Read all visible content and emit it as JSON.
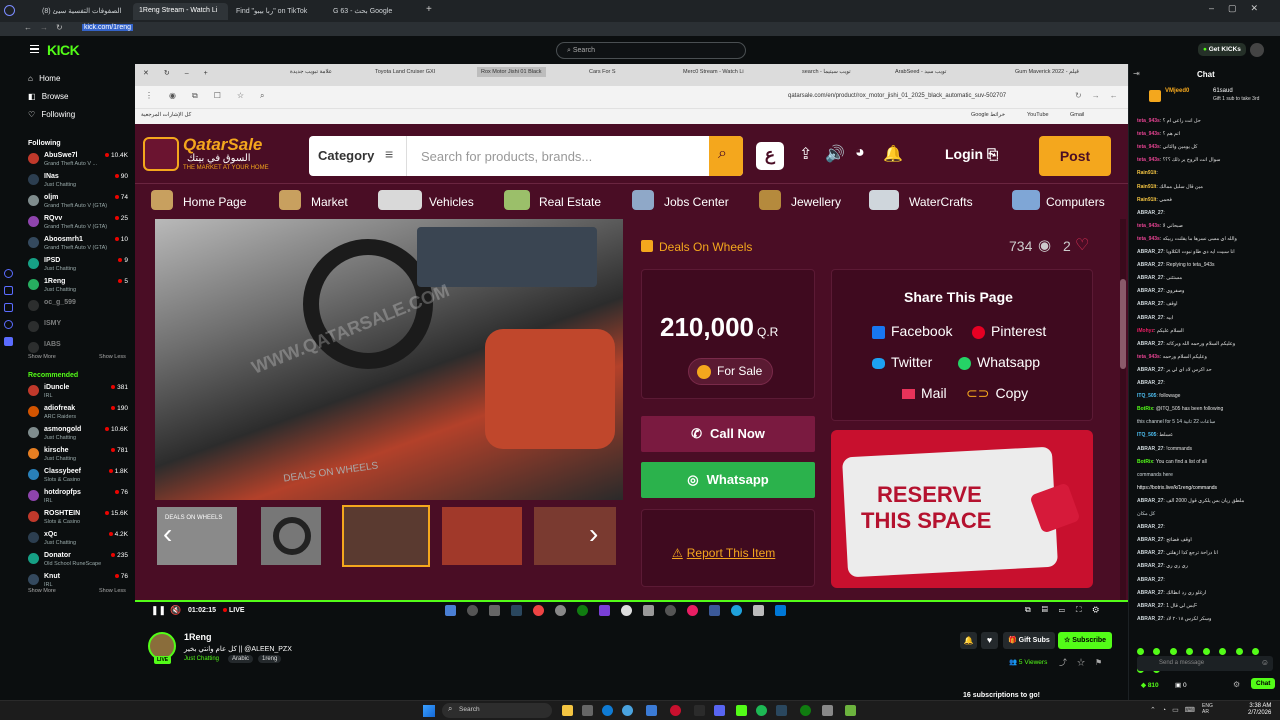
{
  "outer_tabs": [
    {
      "label": "(8) الصفوفات التفسية سيئ"
    },
    {
      "label": "1Reng Stream - Watch Li"
    },
    {
      "label": "Find \"ربا بيبو\" on TikTok"
    },
    {
      "label": "G 63 - بحث Google"
    }
  ],
  "outer_url": "kick.com/1reng",
  "kick": {
    "logo": "KICK",
    "search_placeholder": "Search",
    "get_kicks": "Get KICKs",
    "nav": [
      "Home",
      "Browse",
      "Following"
    ],
    "following_heading": "Following",
    "following": [
      {
        "name": "AbuSwe7l",
        "category": "Grand Theft Auto V ...",
        "viewers": "10.4K",
        "color": "#c0392b"
      },
      {
        "name": "INas",
        "category": "Just Chatting",
        "viewers": "90",
        "color": "#2c3e50"
      },
      {
        "name": "oljm",
        "category": "Grand Theft Auto V (GTA)",
        "viewers": "74",
        "color": "#7f8c8d"
      },
      {
        "name": "RQvv",
        "category": "Grand Theft Auto V (GTA)",
        "viewers": "25",
        "color": "#8e44ad"
      },
      {
        "name": "Aboosmrh1",
        "category": "Grand Theft Auto V (GTA)",
        "viewers": "10",
        "color": "#34495e"
      },
      {
        "name": "IPSD",
        "category": "Just Chatting",
        "viewers": "9",
        "color": "#16a085"
      },
      {
        "name": "1Reng",
        "category": "Just Chatting",
        "viewers": "5",
        "color": "#27ae60"
      },
      {
        "name": "oc_g_599",
        "category": "",
        "viewers": "",
        "color": "#555"
      },
      {
        "name": "ISMY",
        "category": "",
        "viewers": "",
        "color": "#555"
      },
      {
        "name": "IABS",
        "category": "",
        "viewers": "",
        "color": "#555"
      }
    ],
    "show_more": "Show More",
    "show_less": "Show Less",
    "recommended_heading": "Recommended",
    "recommended": [
      {
        "name": "iDuncle",
        "category": "IRL",
        "viewers": "381",
        "color": "#c0392b"
      },
      {
        "name": "adiofreak",
        "category": "ARC Raiders",
        "viewers": "190",
        "color": "#d35400"
      },
      {
        "name": "asmongold",
        "category": "Just Chatting",
        "viewers": "10.6K",
        "color": "#7f8c8d"
      },
      {
        "name": "kirsche",
        "category": "Just Chatting",
        "viewers": "781",
        "color": "#e67e22"
      },
      {
        "name": "Classybeef",
        "category": "Slots & Casino",
        "viewers": "1.8K",
        "color": "#2980b9"
      },
      {
        "name": "hotdropfps",
        "category": "IRL",
        "viewers": "76",
        "color": "#8e44ad"
      },
      {
        "name": "ROSHTEIN",
        "category": "Slots & Casino",
        "viewers": "15.6K",
        "color": "#c0392b"
      },
      {
        "name": "xQc",
        "category": "Just Chatting",
        "viewers": "4.2K",
        "color": "#2c3e50"
      },
      {
        "name": "Donator",
        "category": "Old School RuneScape",
        "viewers": "235",
        "color": "#16a085"
      },
      {
        "name": "Knut",
        "category": "IRL",
        "viewers": "76",
        "color": "#34495e"
      }
    ]
  },
  "inner_browser": {
    "tabs": [
      "علامة تبويب جديدة",
      "Toyota Land Cruiser GXI",
      "Rox Motor Jishi 01 Black",
      "Cars For S",
      "Merc0 Stream - Watch Li",
      "search - تويب سيتيما",
      "ArabSeed - تويب سيد",
      "Gum Maverick 2022 - قيلم"
    ],
    "url": "qatarsale.com/en/product/rox_motor_jishi_01_2025_black_automatic_suv-502707",
    "bookmark_left": "كل الإشارات المرجعية",
    "bookmarks_right": [
      "Google خرائط",
      "YouTube",
      "Gmail"
    ]
  },
  "site": {
    "logo_title": "QatarSale",
    "logo_arabic": "السوق في بيتك",
    "logo_tagline": "THE MARKET AT YOUR HOME",
    "category": "Category",
    "search_placeholder": "Search for products, brands...",
    "lang": "ع",
    "login": "Login",
    "post": "Post",
    "nav": [
      "Home Page",
      "Market",
      "Vehicles",
      "Real Estate",
      "Jobs Center",
      "Jewellery",
      "WaterCrafts",
      "Computers"
    ],
    "seller": "Deals On Wheels",
    "views": "734",
    "likes": "2",
    "price": "210,000",
    "currency": "Q.R",
    "sale_badge": "For Sale",
    "call_now": "Call Now",
    "whatsapp": "Whatsapp",
    "report": "Report This Item",
    "share_title": "Share This Page",
    "share": [
      "Facebook",
      "Pinterest",
      "Twitter",
      "Whatsapp",
      "Mail",
      "Copy"
    ],
    "reserve_line1": "RESERVE",
    "reserve_line2": "THIS SPACE",
    "watermark": "WWW.QATARSALE.COM",
    "floor_mat": "DEALS ON WHEELS",
    "thumb_label": "DEALS ON WHEELS"
  },
  "player": {
    "time": "01:02:15",
    "live": "LIVE"
  },
  "stream_info": {
    "channel": "1Reng",
    "title": "كل عام وانتي بخير || @ALEEN_PZX",
    "category": "Just Chatting",
    "tags": [
      "Arabic",
      "1reng"
    ],
    "live_badge": "LIVE",
    "gift_subs": "Gift Subs",
    "subscribe": "Subscribe",
    "viewers": "5 Viewers",
    "subs_banner": "16 subscriptions to go!"
  },
  "chat": {
    "title": "Chat",
    "pinned_user": "VMjeed0",
    "pinned_badge": "61saud",
    "pinned_text": "Gift 1 sub to take 3rd",
    "messages": [
      {
        "user": "teta_943s",
        "text": "حل انت راعي ام ؟",
        "color": "#e84393"
      },
      {
        "user": "teta_943s",
        "text": "اتم هم ؟",
        "color": "#e84393"
      },
      {
        "user": "teta_943s",
        "text": "كل يومين والثاني",
        "color": "#e84393"
      },
      {
        "user": "teta_943s",
        "text": "سوال انت الروح ير ذلك ؟؟؟",
        "color": "#e84393"
      },
      {
        "user": "Rain91lt",
        "text": "",
        "color": "#f5c542"
      },
      {
        "user": "Rain91lt",
        "text": "مين قال سلبل ممالك",
        "color": "#f5c542"
      },
      {
        "user": "Rain91lt",
        "text": "فحمي",
        "color": "#f5c542"
      },
      {
        "user": "ABRAR_27",
        "text": "",
        "color": "#cfd8dc"
      },
      {
        "user": "teta_943s",
        "text": "صبحاني لا",
        "color": "#e84393"
      },
      {
        "user": "teta_943s",
        "text": "والله اي مسى نسرها ما يقلنت ربيكه",
        "color": "#e84393"
      },
      {
        "user": "ABRAR_27",
        "text": "انا سبيت ايه دي طاو نبوت الكلاويا",
        "color": "#cfd8dc"
      },
      {
        "user": "ABRAR_27",
        "text": "Replying to teta_943s",
        "color": "#cfd8dc"
      },
      {
        "user": "ABRAR_27",
        "text": "مستثنى",
        "color": "#cfd8dc"
      },
      {
        "user": "ABRAR_27",
        "text": "وصفروي",
        "color": "#cfd8dc"
      },
      {
        "user": "ABRAR_27",
        "text": "اوقف",
        "color": "#cfd8dc"
      },
      {
        "user": "ABRAR_27",
        "text": "ابيه",
        "color": "#cfd8dc"
      },
      {
        "user": "iMohyz",
        "text": "السلام عليكم",
        "color": "#e91e63"
      },
      {
        "user": "ABRAR_27",
        "text": "وعليكم السلام ورحمه الله وبركاته",
        "color": "#cfd8dc"
      },
      {
        "user": "teta_943s",
        "text": "وعليكم السلام ورحمه",
        "color": "#e84393"
      },
      {
        "user": "ABRAR_27",
        "text": "حد اكرس لاد اي لي ير",
        "color": "#cfd8dc"
      },
      {
        "user": "ABRAR_27",
        "text": "",
        "color": "#cfd8dc"
      },
      {
        "user": "ITQ_505",
        "text": "followage",
        "color": "#4fc3f7"
      },
      {
        "user": "BotRix",
        "text": "@ITQ_505 has been following",
        "color": "#53fc18"
      },
      {
        "user": "",
        "text": "this channel for 5 ساعات 22 ثانية 14",
        "color": "#cfd8dc"
      },
      {
        "user": "ITQ_505",
        "text": "عسلط",
        "color": "#4fc3f7"
      },
      {
        "user": "ABRAR_27",
        "text": "!commands",
        "color": "#cfd8dc"
      },
      {
        "user": "BotRix",
        "text": "You can find a list of all",
        "color": "#53fc18"
      },
      {
        "user": "",
        "text": "commands here",
        "color": "#cfd8dc"
      },
      {
        "user": "",
        "text": "https://botrix.live/k/1reng/commands",
        "color": "#ffffff"
      },
      {
        "user": "ABRAR_27",
        "text": "ملطق ريان بس يلكري قول 2000 ألف",
        "color": "#cfd8dc"
      },
      {
        "user": "",
        "text": "كل مكان",
        "color": "#cfd8dc"
      },
      {
        "user": "ABRAR_27",
        "text": "",
        "color": "#cfd8dc"
      },
      {
        "user": "ABRAR_27",
        "text": "اوقف فضائح",
        "color": "#cfd8dc"
      },
      {
        "user": "ABRAR_27",
        "text": "انا دراحة ترجع كذا ازهلتي",
        "color": "#cfd8dc"
      },
      {
        "user": "ABRAR_27",
        "text": "ري ري ري",
        "color": "#cfd8dc"
      },
      {
        "user": "ABRAR_27",
        "text": "",
        "color": "#cfd8dc"
      },
      {
        "user": "ABRAR_27",
        "text": "ارغلو ري رد انطالك",
        "color": "#cfd8dc"
      },
      {
        "user": "ABRAR_27",
        "text": "بس لي قال 1F",
        "color": "#cfd8dc"
      },
      {
        "user": "ABRAR_27",
        "text": "وسكر لكرس ٢٠١٨ لاد",
        "color": "#cfd8dc"
      }
    ],
    "send_placeholder": "Send a message",
    "points": "810",
    "count": "0",
    "chat_button": "Chat"
  },
  "taskbar": {
    "search": "Search",
    "time": "3:38 AM",
    "date": "2/7/2026",
    "lang": "ENG",
    "region": "AR"
  }
}
